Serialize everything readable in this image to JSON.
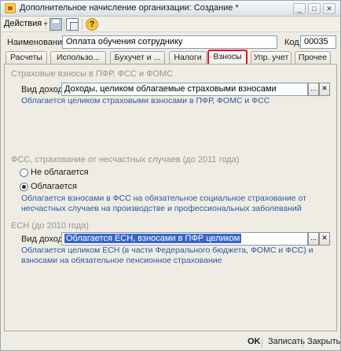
{
  "window": {
    "title": "Дополнительное начисление организации: Создание *"
  },
  "window_controls": {
    "minimize": "_",
    "maximize": "□",
    "close": "✕"
  },
  "toolbar": {
    "actions_label": "Действия",
    "actions_arrow": "▾",
    "help_glyph": "?"
  },
  "header": {
    "name_label": "Наименование:",
    "name_value": "Оплата обучения сотруднику",
    "code_label": "Код:",
    "code_value": "00035"
  },
  "tabs": [
    {
      "label": "Расчеты"
    },
    {
      "label": "Использо..."
    },
    {
      "label": "Бухучет и ..."
    },
    {
      "label": "Налоги"
    },
    {
      "label": "Взносы",
      "active": true
    },
    {
      "label": "Упр. учет"
    },
    {
      "label": "Прочее"
    }
  ],
  "pfr": {
    "title": "Страховые взносы в ПФР, ФСС и ФОМС",
    "income_label": "Вид дохода:",
    "income_value": "Доходы, целиком облагаемые страховыми взносами",
    "picker_glyph": "...",
    "clear_glyph": "✕",
    "hint": "Облагается целиком страховыми взносами в ПФР, ФОМС и ФСС"
  },
  "fss": {
    "title": "ФСС, страхование от несчастных случаев (до 2011 года)",
    "option_not_taxed": "Не облагается",
    "option_taxed": "Облагается",
    "selected": "Облагается",
    "hint_line1": "Облагается взносами в ФСС на обязательное социальное страхование от",
    "hint_line2": "несчастных случаев на производстве и профессиональных заболеваний"
  },
  "esn": {
    "title": "ЕСН (до 2010 года)",
    "income_label": "Вид дохода:",
    "income_value": "Облагается ЕСН, взносами в ПФР целиком",
    "picker_glyph": "...",
    "clear_glyph": "✕",
    "hint_line1": "Облагается целиком ЕСН (в части Федерального бюджета, ФОМС и ФСС) и",
    "hint_line2": "взносами на обязательное пенсионное страхование"
  },
  "footer": {
    "ok_label": "OK",
    "save_label": "Записать",
    "close_label": "Закрыть"
  }
}
